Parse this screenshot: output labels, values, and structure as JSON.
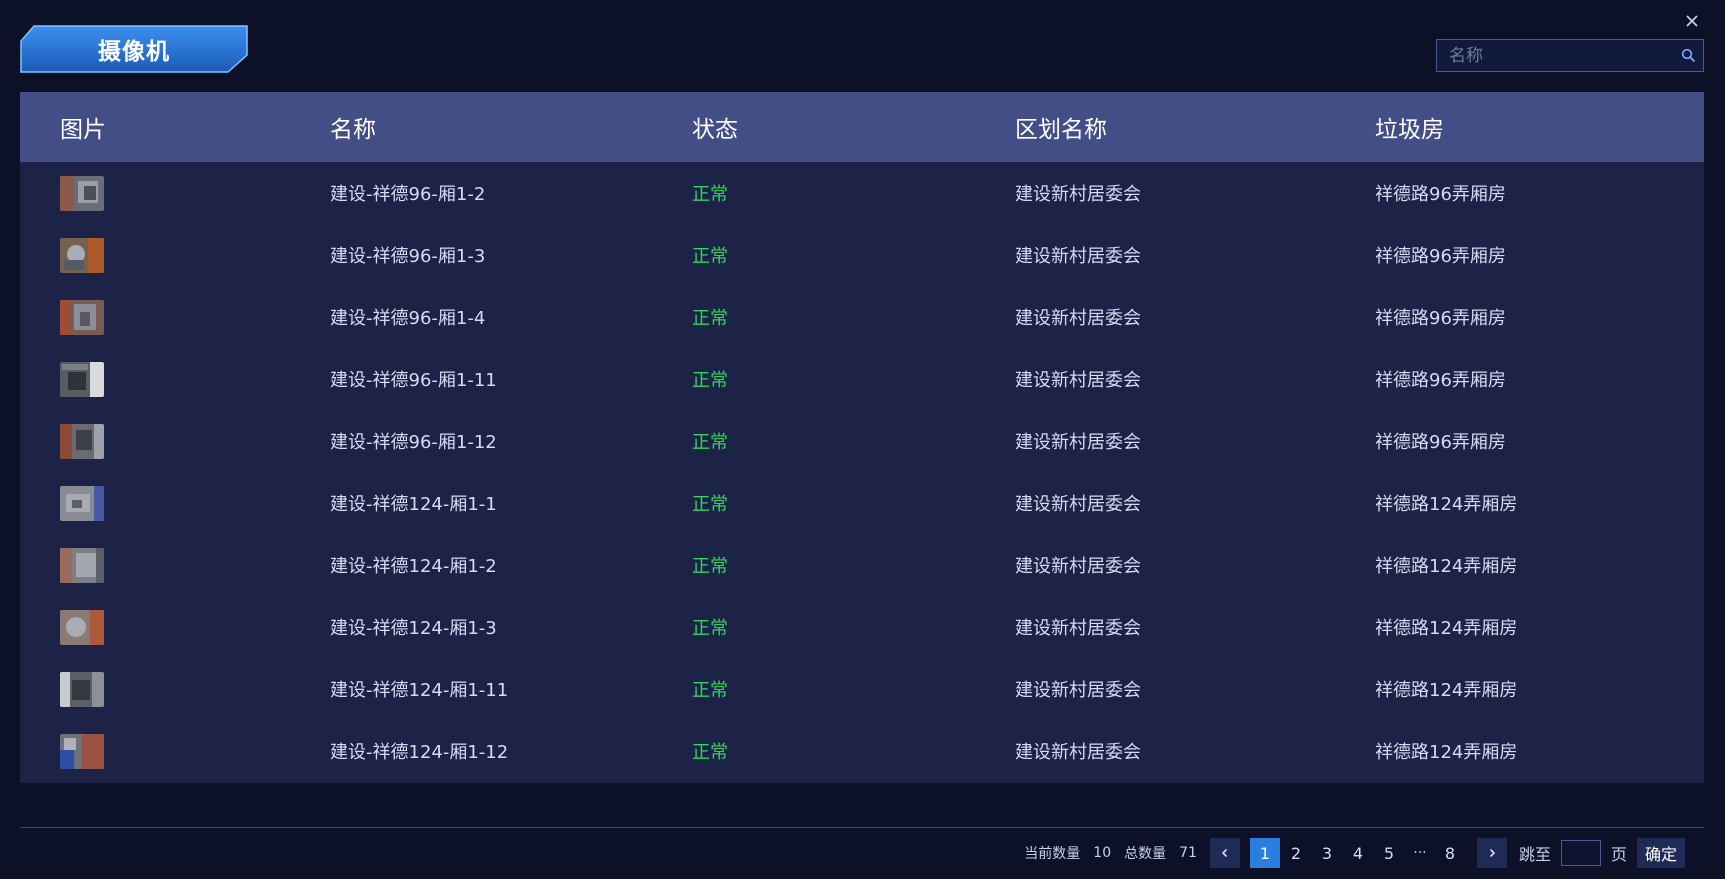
{
  "title": "摄像机",
  "search": {
    "placeholder": "名称",
    "value": ""
  },
  "table": {
    "headers": [
      "图片",
      "名称",
      "状态",
      "区划名称",
      "垃圾房"
    ],
    "rows": [
      {
        "name": "建设-祥德96-厢1-2",
        "status": "正常",
        "district": "建设新村居委会",
        "room": "祥德路96弄厢房"
      },
      {
        "name": "建设-祥德96-厢1-3",
        "status": "正常",
        "district": "建设新村居委会",
        "room": "祥德路96弄厢房"
      },
      {
        "name": "建设-祥德96-厢1-4",
        "status": "正常",
        "district": "建设新村居委会",
        "room": "祥德路96弄厢房"
      },
      {
        "name": "建设-祥德96-厢1-11",
        "status": "正常",
        "district": "建设新村居委会",
        "room": "祥德路96弄厢房"
      },
      {
        "name": "建设-祥德96-厢1-12",
        "status": "正常",
        "district": "建设新村居委会",
        "room": "祥德路96弄厢房"
      },
      {
        "name": "建设-祥德124-厢1-1",
        "status": "正常",
        "district": "建设新村居委会",
        "room": "祥德路124弄厢房"
      },
      {
        "name": "建设-祥德124-厢1-2",
        "status": "正常",
        "district": "建设新村居委会",
        "room": "祥德路124弄厢房"
      },
      {
        "name": "建设-祥德124-厢1-3",
        "status": "正常",
        "district": "建设新村居委会",
        "room": "祥德路124弄厢房"
      },
      {
        "name": "建设-祥德124-厢1-11",
        "status": "正常",
        "district": "建设新村居委会",
        "room": "祥德路124弄厢房"
      },
      {
        "name": "建设-祥德124-厢1-12",
        "status": "正常",
        "district": "建设新村居委会",
        "room": "祥德路124弄厢房"
      }
    ]
  },
  "pagination": {
    "current_count_label": "当前数量",
    "current_count": "10",
    "total_label": "总数量",
    "total": "71",
    "pages": [
      "1",
      "2",
      "3",
      "4",
      "5"
    ],
    "ellipsis": "···",
    "last_page": "8",
    "active_page": "1",
    "jump_label": "跳至",
    "page_unit": "页",
    "confirm_label": "确定"
  },
  "colors": {
    "background": "#0c1128",
    "header_bg": "#434e86",
    "body_bg": "#1c2347",
    "status_ok": "#2fd55e",
    "active_page": "#2a7ee0"
  },
  "icons": {
    "close": "close-icon",
    "search": "search-icon",
    "prev": "chevron-left-icon",
    "next": "chevron-right-icon"
  }
}
